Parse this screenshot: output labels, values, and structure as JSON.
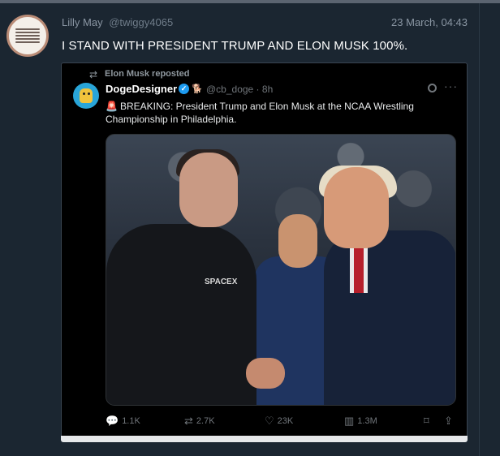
{
  "post": {
    "author_name": "Lilly May",
    "author_handle": "@twiggy4065",
    "date": "23 March, 04:43",
    "text": "I STAND WITH PRESIDENT TRUMP AND ELON MUSK 100%."
  },
  "embed": {
    "repost_label": "Elon Musk reposted",
    "name": "DogeDesigner",
    "handle_time": "@cb_doge · 8h",
    "siren_icon": "🚨",
    "text": "BREAKING: President Trump and Elon Musk at the NCAA Wrestling Championship in Philadelphia.",
    "shirt_text": "SPACEX",
    "stats": {
      "replies": "1.1K",
      "reposts": "2.7K",
      "likes": "23K",
      "views": "1.3M"
    }
  },
  "colors": {
    "background": "#1b2631",
    "embed_bg": "#000000",
    "verified": "#1d9bf0",
    "muted": "#71767b"
  }
}
